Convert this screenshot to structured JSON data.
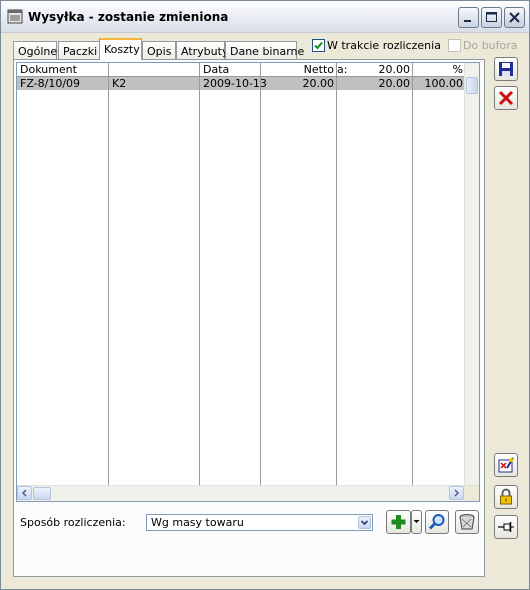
{
  "window": {
    "title": "Wysyłka - zostanie zmieniona",
    "controls": {
      "minimize": "minimize-icon",
      "maximize": "maximize-icon",
      "close": "close-icon"
    }
  },
  "tabs": [
    {
      "label": "Ogólne",
      "active": false
    },
    {
      "label": "Paczki",
      "active": false
    },
    {
      "label": "Koszty",
      "active": true
    },
    {
      "label": "Opis",
      "active": false
    },
    {
      "label": "Atrybuty",
      "active": false
    },
    {
      "label": "Dane binarne",
      "active": false
    }
  ],
  "checkboxes": {
    "w_trakcie": {
      "label": "W trakcie rozliczenia",
      "checked": true,
      "enabled": true
    },
    "do_bufora": {
      "label": "Do bufora",
      "checked": false,
      "enabled": false
    }
  },
  "table": {
    "headers": {
      "dokument": "Dokument",
      "data": "Data",
      "netto": "Netto",
      "a": "a:",
      "amount": "20.00",
      "percent": "%"
    },
    "rows": [
      {
        "dokument": "FZ-8/10/09",
        "code": "K2",
        "data": "2009-10-13",
        "netto": "20.00",
        "a": "20.00",
        "percent": "100.00"
      }
    ]
  },
  "footer": {
    "sposob_label": "Sposób rozliczenia:",
    "sposob_value": "Wg masy towaru"
  },
  "colors": {
    "selected_row": "#c0c0c0",
    "active_tab_accent": "#f5b53a",
    "check_green": "#1f8a1f",
    "cancel_red": "#cc1111",
    "save_blue": "#1c2f9c"
  },
  "icons": {
    "save": "save-icon",
    "cancel": "cancel-icon",
    "add": "add-icon",
    "search": "magnifier-icon",
    "delete": "trash-icon",
    "edit": "edit-document-icon",
    "lock": "lock-icon",
    "pin": "pin-icon"
  }
}
